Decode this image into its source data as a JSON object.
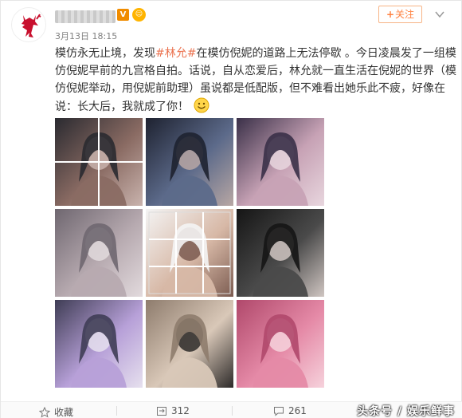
{
  "post": {
    "badges": {
      "vip": "V",
      "level": "☺"
    },
    "timestamp": "3月13日 18:15",
    "follow_plus": "+",
    "follow_label": "关注",
    "text": {
      "part1": "模仿永无止境，发现",
      "hashtag": "#林允#",
      "part2": "在模仿倪妮的道路上无法停歇 。今日凌晨发了一组模仿倪妮早前的九宫格自拍。话说，自从恋爱后，林允就一直生活在倪妮的世界（模仿倪妮举动，用倪妮前助理）虽说都是低配版，但不难看出她乐此不疲，好像在说：长大后，我就成了你！"
    },
    "images": [
      {
        "icon": "collage-photo-1",
        "palette": [
          "#2a2a30",
          "#8a6b63",
          "#c9b3ad"
        ]
      },
      {
        "icon": "portrait-photo-2",
        "palette": [
          "#1e2230",
          "#5c6a8a",
          "#b8a7a4"
        ]
      },
      {
        "icon": "portrait-photo-3",
        "palette": [
          "#3a3048",
          "#c7a2b5",
          "#e8d6de"
        ]
      },
      {
        "icon": "portrait-photo-4",
        "palette": [
          "#6f6770",
          "#b7aab0",
          "#e2dadd"
        ]
      },
      {
        "icon": "screenshot-grid-photo-5",
        "palette": [
          "#f4f4f4",
          "#d7b8a6",
          "#7b5b50"
        ]
      },
      {
        "icon": "portrait-photo-6",
        "palette": [
          "#151515",
          "#4a4a4a",
          "#d0c6c2"
        ]
      },
      {
        "icon": "fullbody-photo-7",
        "palette": [
          "#3f3d55",
          "#b7a0d8",
          "#e6e0ee"
        ]
      },
      {
        "icon": "pet-photo-8",
        "palette": [
          "#8e7c6d",
          "#d9c8b8",
          "#2d2a29"
        ]
      },
      {
        "icon": "pink-photo-9",
        "palette": [
          "#b0486b",
          "#e58aa7",
          "#f6d2dc"
        ]
      }
    ]
  },
  "footer": {
    "collect_label": "收藏",
    "repost_count": "312",
    "comment_count": "261",
    "watermark": "头条号 / 娱乐鲜事"
  }
}
